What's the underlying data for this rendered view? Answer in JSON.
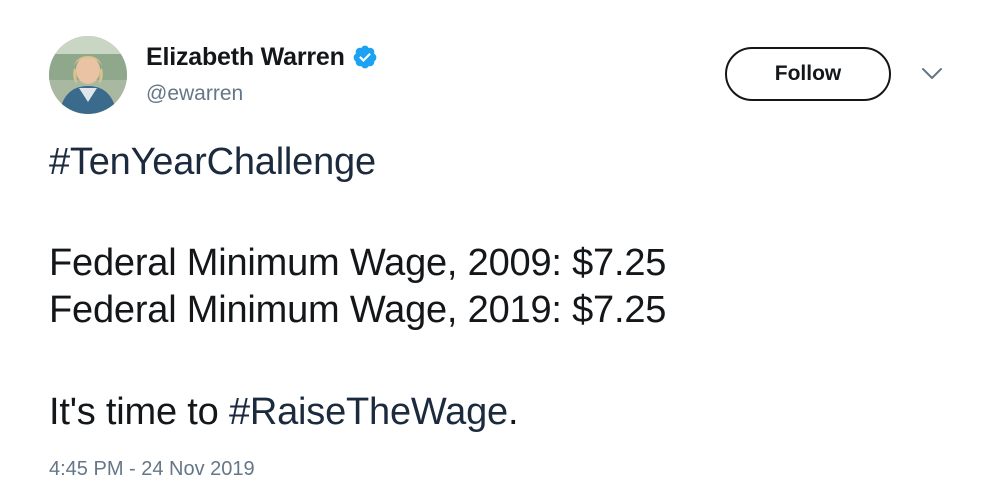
{
  "author": {
    "display_name": "Elizabeth Warren",
    "handle": "@ewarren",
    "verified": true
  },
  "follow_button": {
    "label": "Follow"
  },
  "tweet": {
    "hashtag_challenge": "#TenYearChallenge",
    "line_2009": "Federal Minimum Wage, 2009: $7.25",
    "line_2019": "Federal Minimum Wage, 2019: $7.25",
    "closing_prefix": "It's time to ",
    "closing_hashtag": "#RaiseTheWage",
    "closing_suffix": "."
  },
  "timestamp": "4:45 PM - 24 Nov 2019",
  "icons": {
    "verified": "verified-badge-icon",
    "caret": "chevron-down-icon"
  },
  "colors": {
    "verified_blue": "#1da1f2",
    "secondary_text": "#657786",
    "primary_text": "#14171a"
  }
}
